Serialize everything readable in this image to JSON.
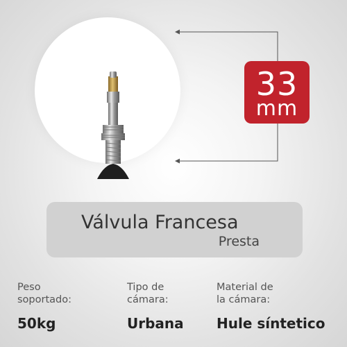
{
  "image": {
    "icon": "presta-valve-icon"
  },
  "size_badge": {
    "value": "33",
    "unit": "mm",
    "color": "#c1232c"
  },
  "title": {
    "main": "Válvula Francesa",
    "sub": "Presta"
  },
  "specs": [
    {
      "label_line1": "Peso",
      "label_line2": "soportado:",
      "value": "50kg"
    },
    {
      "label_line1": "Tipo de",
      "label_line2": "cámara:",
      "value": "Urbana"
    },
    {
      "label_line1": "Material de",
      "label_line2": "la cámara:",
      "value": "Hule síntetico"
    }
  ]
}
